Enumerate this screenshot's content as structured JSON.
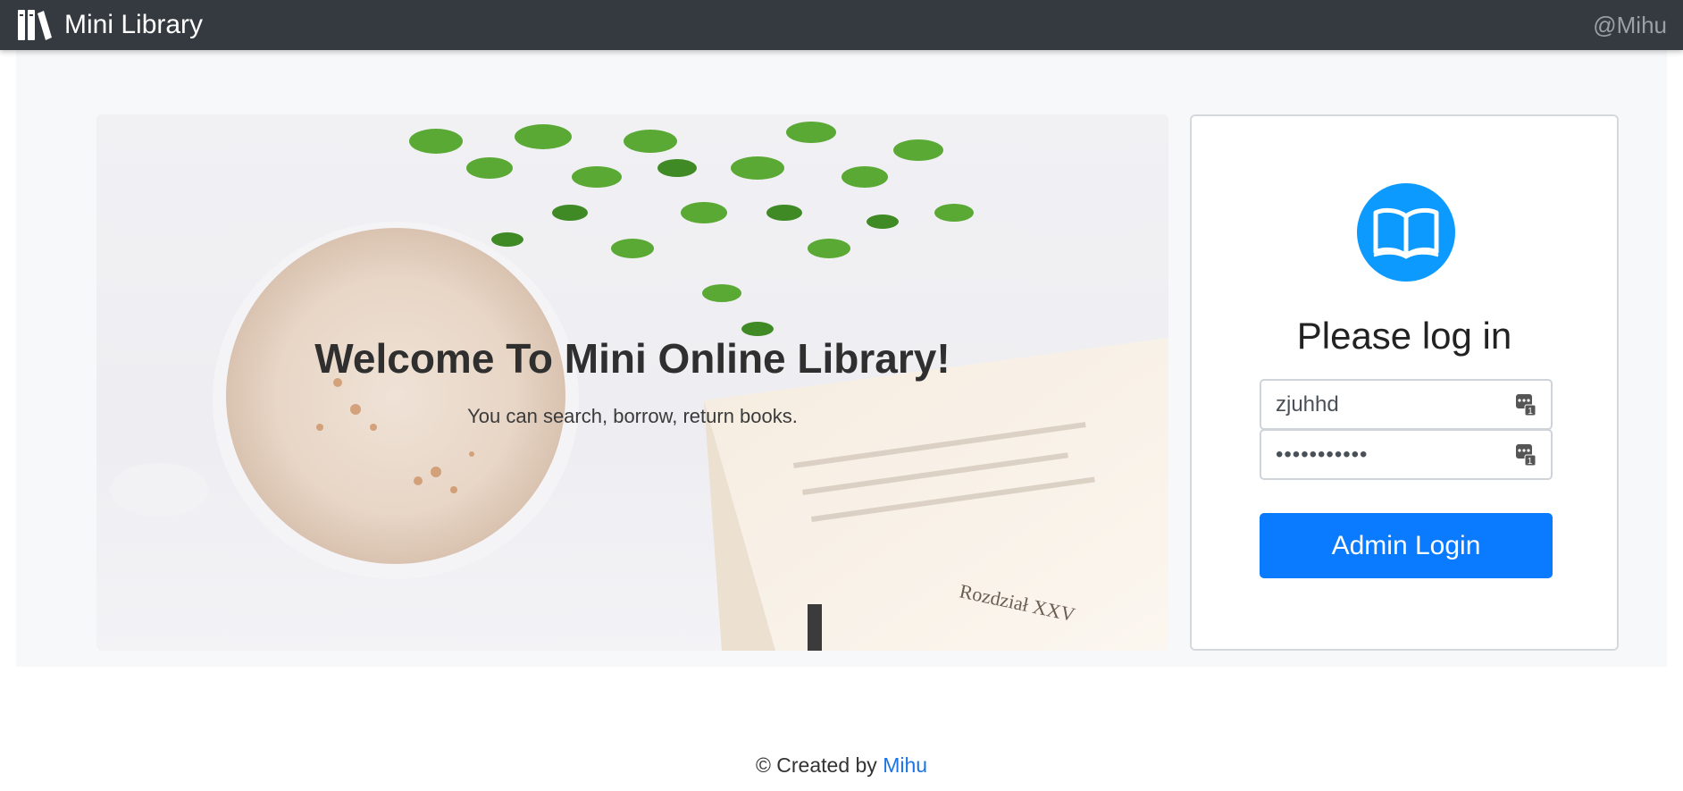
{
  "navbar": {
    "brand": "Mini Library",
    "user": "@Mihu"
  },
  "hero": {
    "title": "Welcome To Mini Online Library!",
    "subtitle": "You can search, borrow, return books.",
    "book_page_heading": "Rozdział XXV"
  },
  "login": {
    "title": "Please log in",
    "username_value": "zjuhhd",
    "password_value": "•••••••••••",
    "button_label": "Admin Login"
  },
  "footer": {
    "prefix": "© Created by ",
    "author": "Mihu"
  },
  "colors": {
    "navbar": "#343a40",
    "accent": "#0a7bff",
    "logo": "#0d9aff",
    "link": "#1a73e8"
  },
  "icons": {
    "brand": "books-icon",
    "logo": "open-book-icon",
    "field": "password-manager-key-icon"
  }
}
